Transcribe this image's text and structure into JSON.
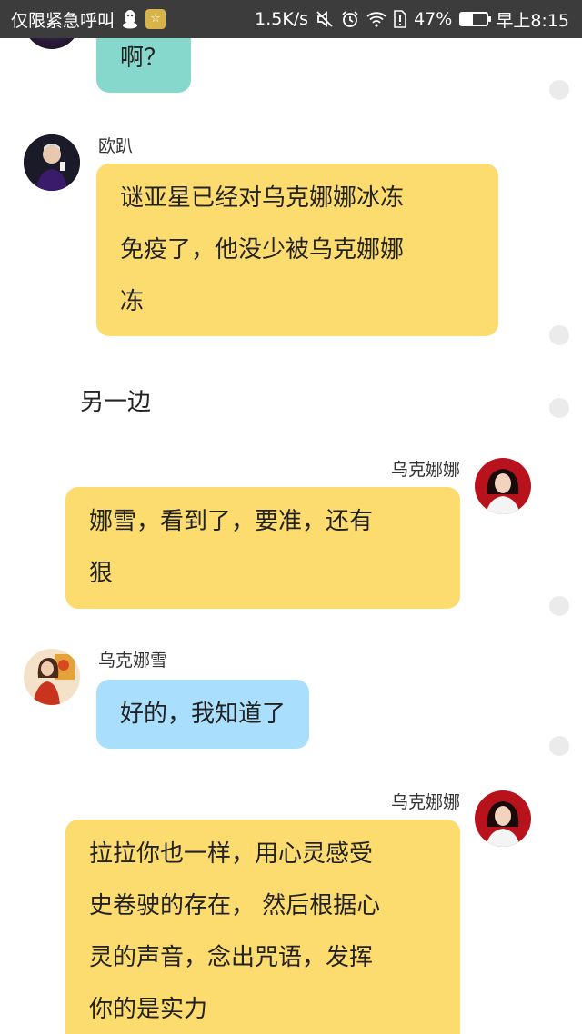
{
  "status_bar": {
    "carrier": "仅限紧急呼叫",
    "speed": "1.5K/s",
    "battery": "47%",
    "battery_level": 0.47,
    "time": "早上8:15",
    "icons": [
      "qq-penguin-icon",
      "cool-face-icon",
      "mute-icon",
      "alarm-icon",
      "wifi-icon",
      "sim-alert-icon",
      "battery-icon"
    ]
  },
  "messages": {
    "m1": {
      "side": "left",
      "color": "#87d8cc",
      "text": "啊？"
    },
    "m2": {
      "side": "left",
      "sender": "欧趴",
      "color": "#fddc6f",
      "lines": [
        "谜亚星已经对乌克娜娜冰冻",
        "免疫了，他没少被乌克娜娜",
        "冻"
      ]
    },
    "narration": "另一边",
    "m3": {
      "side": "right",
      "sender": "乌克娜娜",
      "color": "#fddc6f",
      "lines": [
        "娜雪，看到了，要准，还有",
        "狠"
      ]
    },
    "m4": {
      "side": "left",
      "sender": "乌克娜雪",
      "color": "#a9dffc",
      "text": "好的，我知道了"
    },
    "m5": {
      "side": "right",
      "sender": "乌克娜娜",
      "color": "#fddc6f",
      "lines": [
        "拉拉你也一样，用心灵感受",
        "史卷驶的存在， 然后根据心",
        "灵的声音，念出咒语，发挥",
        "你的是实力"
      ]
    }
  }
}
